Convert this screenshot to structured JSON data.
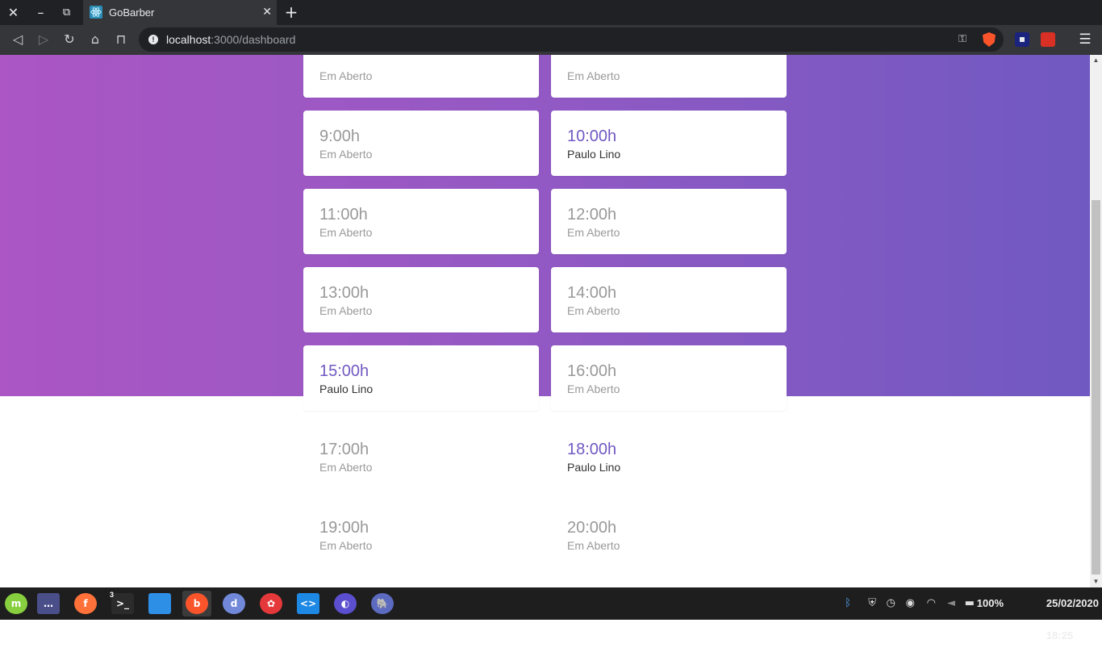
{
  "browser": {
    "tab_title": "GoBarber",
    "url_host": "localhost",
    "url_rest": ":3000/dashboard",
    "icons": [
      "close-icon",
      "minimize-icon",
      "restore-icon",
      "react-icon",
      "tab-close-icon",
      "plus-icon",
      "back-icon",
      "forward-icon",
      "reload-icon",
      "home-icon",
      "bookmark-icon",
      "info-icon",
      "key-icon",
      "brave-shield-icon",
      "extension-icon",
      "menu-icon"
    ]
  },
  "schedule": {
    "slots": [
      {
        "time": "",
        "status": "Em Aberto",
        "booked": false
      },
      {
        "time": "",
        "status": "Em Aberto",
        "booked": false
      },
      {
        "time": "9:00h",
        "status": "Em Aberto",
        "booked": false
      },
      {
        "time": "10:00h",
        "status": "Paulo Lino",
        "booked": true
      },
      {
        "time": "11:00h",
        "status": "Em Aberto",
        "booked": false
      },
      {
        "time": "12:00h",
        "status": "Em Aberto",
        "booked": false
      },
      {
        "time": "13:00h",
        "status": "Em Aberto",
        "booked": false
      },
      {
        "time": "14:00h",
        "status": "Em Aberto",
        "booked": false
      },
      {
        "time": "15:00h",
        "status": "Paulo Lino",
        "booked": true
      },
      {
        "time": "16:00h",
        "status": "Em Aberto",
        "booked": false
      },
      {
        "time": "17:00h",
        "status": "Em Aberto",
        "booked": false
      },
      {
        "time": "18:00h",
        "status": "Paulo Lino",
        "booked": true
      },
      {
        "time": "19:00h",
        "status": "Em Aberto",
        "booked": false
      },
      {
        "time": "20:00h",
        "status": "Em Aberto",
        "booked": false
      }
    ]
  },
  "colors": {
    "gradient_start": "#ab56c4",
    "gradient_end": "#7059c1",
    "booked_time": "#7159c1",
    "open_text": "#999999",
    "booked_name": "#333333"
  },
  "taskbar": {
    "apps": [
      {
        "icon": "linux-mint-menu-icon",
        "color": "#87cf3e",
        "glyph": "m"
      },
      {
        "icon": "show-desktop-icon",
        "color": "#4a4f8a",
        "glyph": "…"
      },
      {
        "icon": "firefox-icon",
        "color": "#ff7139",
        "glyph": "f"
      },
      {
        "icon": "terminal-icon",
        "color": "#2b2b2b",
        "glyph": ">_",
        "badge": "3"
      },
      {
        "icon": "files-icon",
        "color": "#2e8fe6",
        "glyph": ""
      },
      {
        "icon": "brave-icon",
        "color": "#fb542b",
        "glyph": "b",
        "active": true
      },
      {
        "icon": "discord-icon",
        "color": "#7289da",
        "glyph": "d"
      },
      {
        "icon": "app-red-icon",
        "color": "#e5383b",
        "glyph": "✿"
      },
      {
        "icon": "vscode-icon",
        "color": "#1e88e5",
        "glyph": "<>"
      },
      {
        "icon": "app-moon-icon",
        "color": "#5b4fcf",
        "glyph": "◐"
      },
      {
        "icon": "app-elephant-icon",
        "color": "#5c6bc0",
        "glyph": "🐘"
      }
    ],
    "battery": "100%",
    "datetime": "25/02/2020 18:25"
  }
}
